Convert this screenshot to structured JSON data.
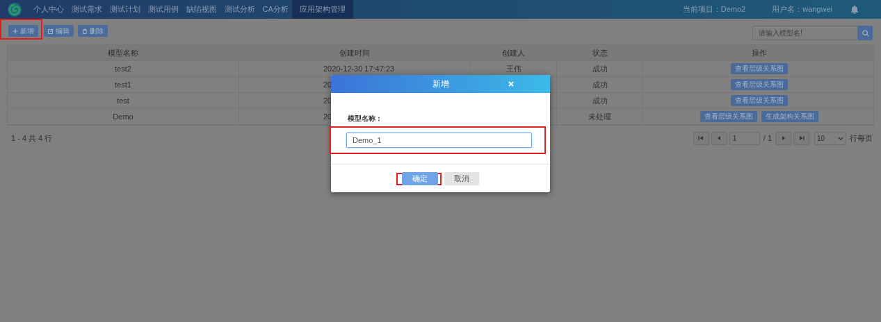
{
  "nav": {
    "items": [
      {
        "label": "个人中心",
        "selected": false
      },
      {
        "label": "测试需求",
        "selected": false
      },
      {
        "label": "测试计划",
        "selected": false
      },
      {
        "label": "测试用例",
        "selected": false
      },
      {
        "label": "缺陷视图",
        "selected": false
      },
      {
        "label": "测试分析",
        "selected": false
      },
      {
        "label": "CA分析",
        "selected": false
      },
      {
        "label": "应用架构管理",
        "selected": true
      }
    ],
    "project": "当前项目：Demo2",
    "user": "用户名：wangwei"
  },
  "toolbar": {
    "buttons": [
      {
        "label": "新增",
        "kind": "add",
        "highlighted": true
      },
      {
        "label": "编辑",
        "kind": "edit",
        "highlighted": false
      },
      {
        "label": "删除",
        "kind": "delete",
        "highlighted": false
      }
    ],
    "search": {
      "placeholder": "请输入模型名!"
    }
  },
  "table": {
    "columns": [
      "模型名称",
      "创建时间",
      "创建人",
      "状态",
      "操作"
    ],
    "rows": [
      {
        "name": "test2",
        "created": "2020-12-30 17:47:23",
        "creator": "王伟",
        "status": "成功",
        "actions": [
          "查看层级关系图"
        ]
      },
      {
        "name": "test1",
        "created": "20",
        "status": "成功",
        "actions": [
          "查看层级关系图"
        ]
      },
      {
        "name": "test",
        "created": "20",
        "status": "成功",
        "actions": [
          "查看层级关系图"
        ]
      },
      {
        "name": "Demo",
        "created": "20",
        "status": "未处理",
        "actions": [
          "查看层级关系图",
          "生成架构关系图"
        ]
      }
    ]
  },
  "pager": {
    "summary": "1 - 4 共 4 行",
    "page": "1",
    "total": "/ 1",
    "page_size": "10",
    "per_page": "行每页"
  },
  "dialog": {
    "title": "新增",
    "field_label": "模型名称：",
    "field_value": "Demo_1",
    "field_highlighted": true,
    "buttons": [
      {
        "label": "确定",
        "kind": "primary",
        "highlighted": true
      },
      {
        "label": "取消",
        "kind": "secondary",
        "highlighted": false
      }
    ]
  }
}
